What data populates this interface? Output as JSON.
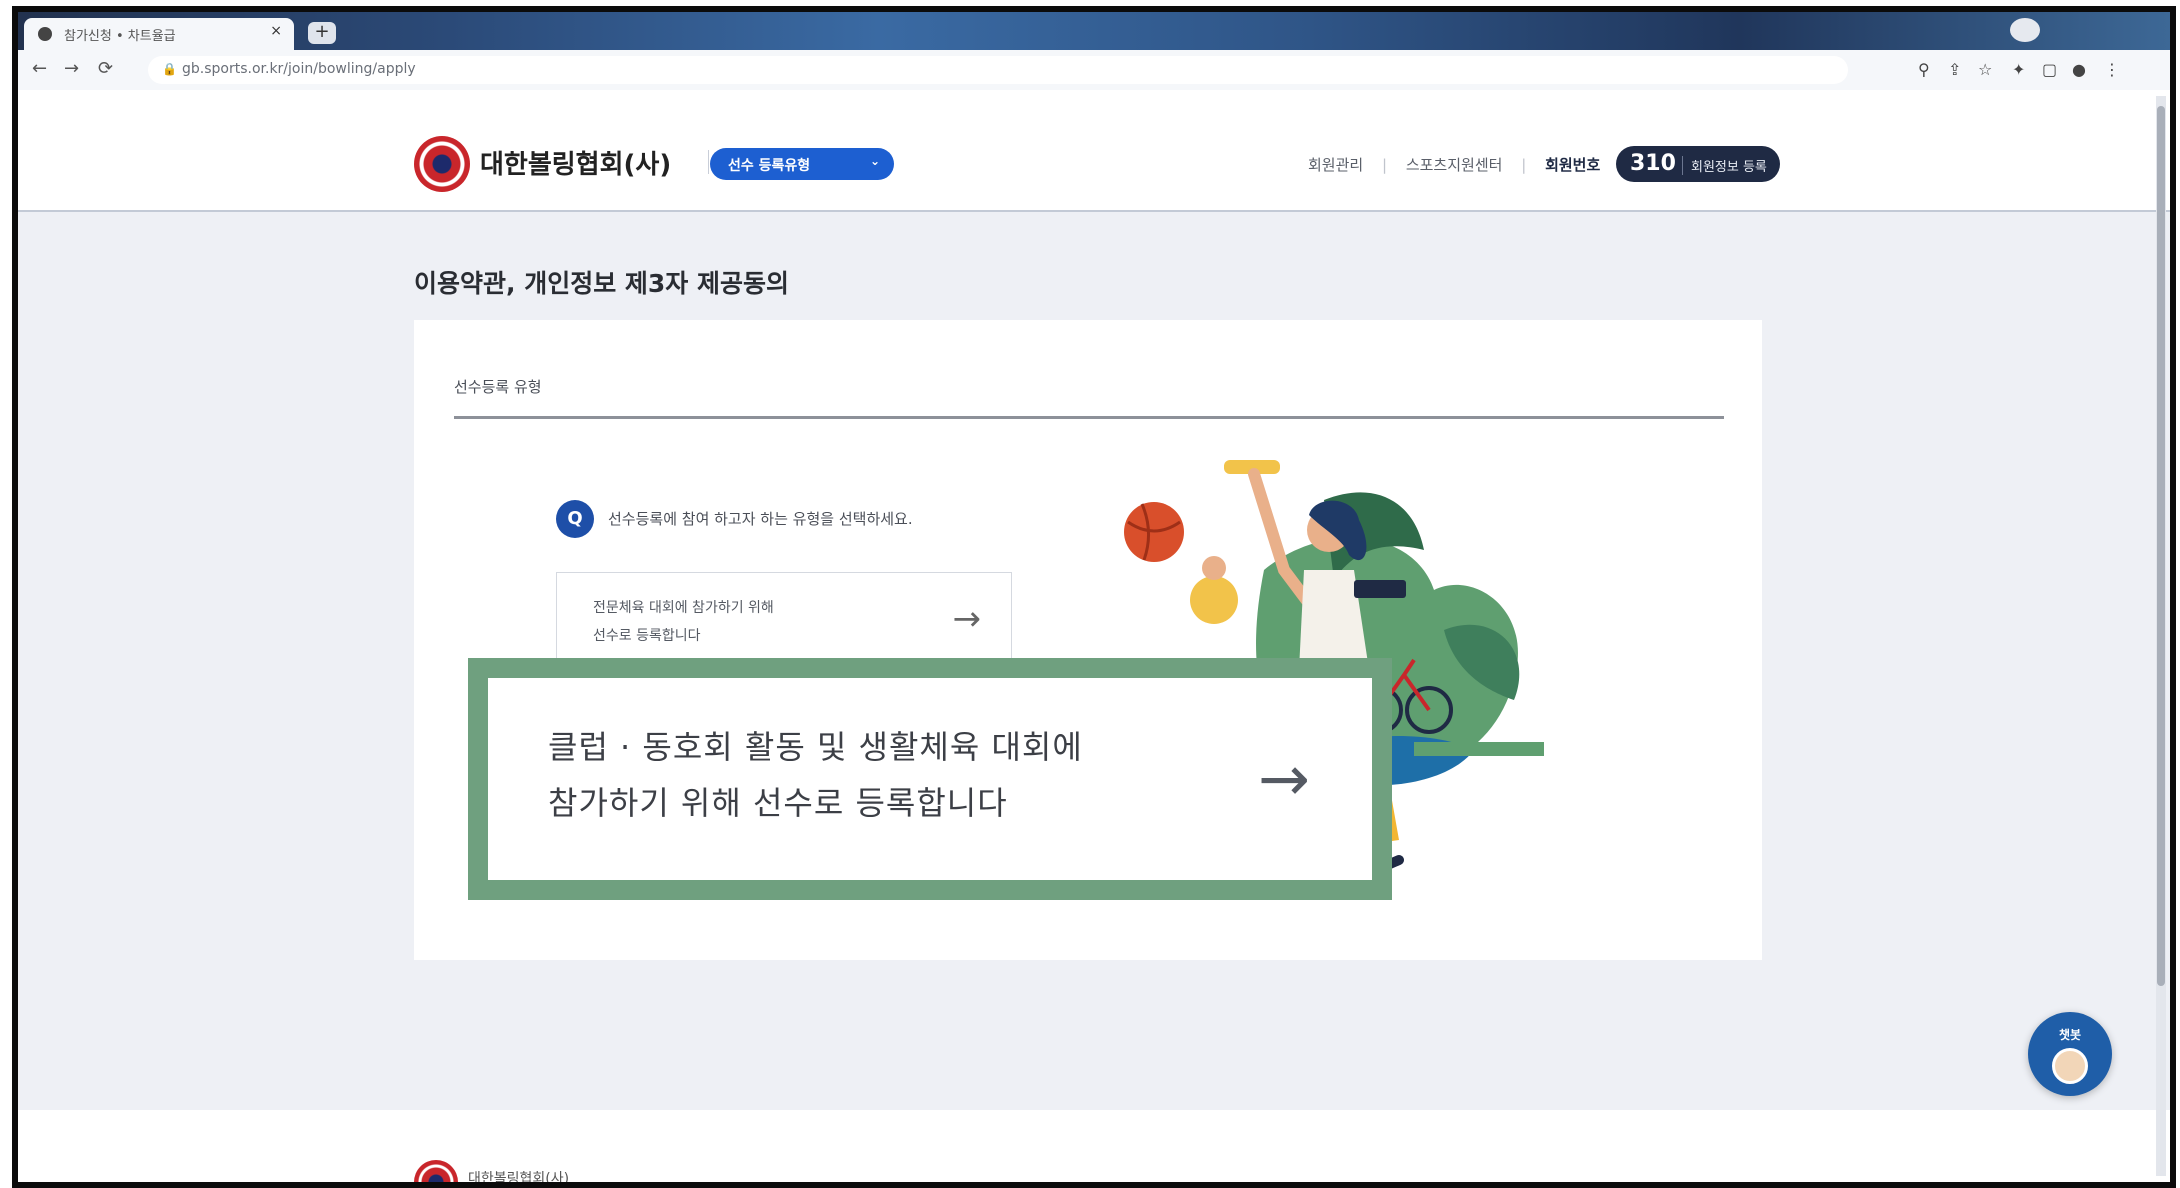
{
  "browser": {
    "tab_title": "참가신청 • 차트율급",
    "tab_close": "×",
    "new_tab": "+",
    "url": "gb.sports.or.kr/join/bowling/apply",
    "lock_icon": "🔒",
    "back_icon": "←",
    "forward_icon": "→",
    "reload_icon": "⟳",
    "toolbar_icons": [
      "⚲",
      "⇪",
      "☆",
      "✦",
      "▢",
      "●",
      "⋮"
    ]
  },
  "header": {
    "org_name": "대한볼링협회(사)",
    "dropdown_label": "선수 등록유형",
    "dropdown_chevron": "⌄",
    "nav_items": [
      "회원관리",
      "스포츠지원센터",
      "회원번호"
    ],
    "counter_value": "310",
    "counter_label": "회원정보 등록"
  },
  "page": {
    "title": "이용약관, 개인정보 제3자 제공동의",
    "section_label": "선수등록 유형",
    "question_badge": "Q",
    "question_text": "선수등록에 참여 하고자 하는 유형을 선택하세요.",
    "options": [
      {
        "line1": "전문체육 대회에 참가하기 위해",
        "line2": "선수로 등록합니다",
        "arrow": "→"
      },
      {
        "line1": "클럽 · 동호회 활동 및 생활체육 대회에",
        "line2": "참가하기 위해 선수로 등록합니다",
        "arrow": "→"
      }
    ]
  },
  "footer": {
    "org_name": "대한볼링협회(사)"
  },
  "chat": {
    "label": "챗봇"
  },
  "colors": {
    "brand_blue": "#1d5fd1",
    "highlight_green": "#6fa07f",
    "navy": "#1f2a44"
  }
}
